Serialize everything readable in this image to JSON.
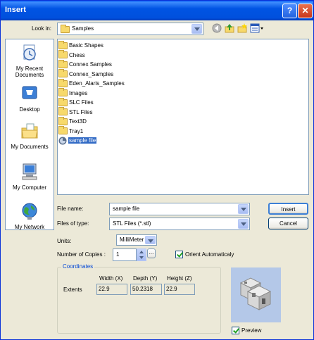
{
  "window": {
    "title": "Insert"
  },
  "title_buttons": {
    "help": "?",
    "close": "✕"
  },
  "look_in": {
    "label": "Look in:",
    "value": "Samples"
  },
  "toolbar": {
    "icons": [
      "back-icon",
      "up-folder-icon",
      "new-folder-icon",
      "views-icon"
    ]
  },
  "places": [
    {
      "label": "My Recent Documents",
      "icon": "recent-documents-icon"
    },
    {
      "label": "Desktop",
      "icon": "desktop-icon"
    },
    {
      "label": "My Documents",
      "icon": "my-documents-icon"
    },
    {
      "label": "My Computer",
      "icon": "my-computer-icon"
    },
    {
      "label": "My Network",
      "icon": "my-network-icon"
    }
  ],
  "files": [
    {
      "name": "Basic Shapes",
      "type": "folder"
    },
    {
      "name": "Chess",
      "type": "folder"
    },
    {
      "name": "Connex Samples",
      "type": "folder"
    },
    {
      "name": "Connex_Samples",
      "type": "folder"
    },
    {
      "name": "Eden_Alaris_Samples",
      "type": "folder"
    },
    {
      "name": "Images",
      "type": "folder"
    },
    {
      "name": "SLC Files",
      "type": "folder"
    },
    {
      "name": "STL Files",
      "type": "folder"
    },
    {
      "name": "Text3D",
      "type": "folder"
    },
    {
      "name": "Tray1",
      "type": "folder"
    },
    {
      "name": "sample file",
      "type": "file",
      "selected": true
    }
  ],
  "file_name": {
    "label": "File name:",
    "value": "sample file"
  },
  "files_of_type": {
    "label": "Files of type:",
    "value": "STL Files (*.stl)"
  },
  "buttons": {
    "insert": "Insert",
    "cancel": "Cancel"
  },
  "units": {
    "label": "Units:",
    "value": "MilliMeter"
  },
  "copies": {
    "label": "Number of Copies :",
    "value": "1",
    "more": "..."
  },
  "orient": {
    "label": "Orient Automaticaly",
    "checked": true
  },
  "coordinates": {
    "title": "Coordinates",
    "headers": [
      "Width (X)",
      "Depth (Y)",
      "Height (Z)"
    ],
    "row_label": "Extents",
    "values": [
      "22.9",
      "50.2318",
      "22.9"
    ]
  },
  "preview": {
    "label": "Preview",
    "checked": true
  },
  "colors": {
    "titlebar": "#0054e3",
    "selection": "#316ac5",
    "dialog": "#ece9d8",
    "group_title": "#0046d5"
  }
}
